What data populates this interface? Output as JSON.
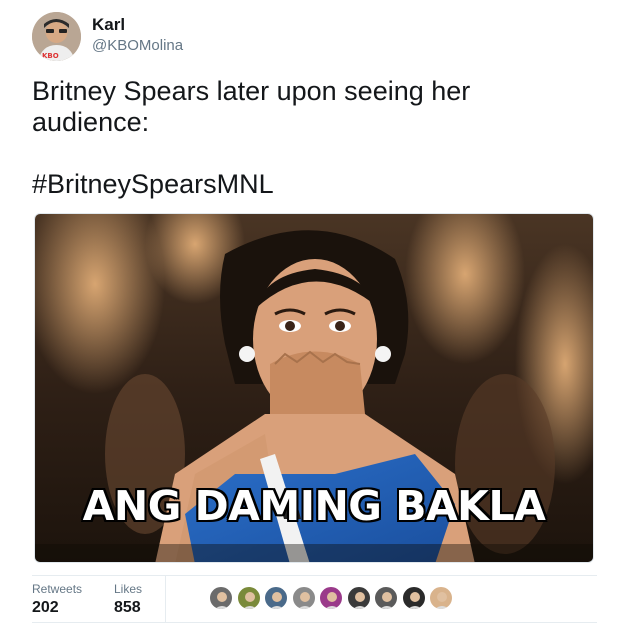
{
  "tweet": {
    "author": {
      "name": "Karl",
      "handle": "@KBOMolina",
      "avatar_icon": "user-avatar-icon"
    },
    "text_line1": "Britney Spears later upon seeing her",
    "text_line2": "audience:",
    "hashtag": "#BritneySpearsMNL",
    "media": {
      "caption": "ANG DAMING BAKLA"
    },
    "stats": {
      "retweets_label": "Retweets",
      "retweets_value": "202",
      "likes_label": "Likes",
      "likes_value": "858"
    },
    "likers": [
      {
        "icon": "liker-avatar-icon",
        "color": "#6b6b6b"
      },
      {
        "icon": "liker-avatar-icon",
        "color": "#7a8a3a"
      },
      {
        "icon": "liker-avatar-icon",
        "color": "#4a6a8a"
      },
      {
        "icon": "liker-avatar-icon",
        "color": "#8a8a8a"
      },
      {
        "icon": "liker-avatar-icon",
        "color": "#9a3a8a"
      },
      {
        "icon": "liker-avatar-icon",
        "color": "#3a3a3a"
      },
      {
        "icon": "liker-avatar-icon",
        "color": "#5a5a5a"
      },
      {
        "icon": "liker-avatar-icon",
        "color": "#2a2a2a"
      },
      {
        "icon": "liker-avatar-icon",
        "color": "#d9b38c"
      }
    ]
  }
}
